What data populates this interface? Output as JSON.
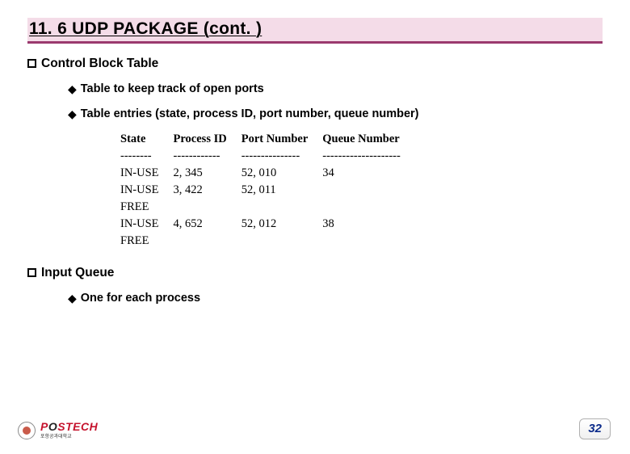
{
  "slide": {
    "title": "11. 6 UDP PACKAGE (cont. )",
    "page_number": "32"
  },
  "sections": [
    {
      "label": "Control Block Table",
      "items": [
        {
          "text": "Table to keep track of open ports"
        },
        {
          "text": "Table entries (state, process ID, port number, queue number)"
        }
      ]
    },
    {
      "label": "Input Queue",
      "items": [
        {
          "text": "One for each process"
        }
      ]
    }
  ],
  "table": {
    "headers": {
      "c0": "State",
      "c1": "Process ID",
      "c2": "Port Number",
      "c3": "Queue Number"
    },
    "dashes": {
      "c0": "--------",
      "c1": "------------",
      "c2": "---------------",
      "c3": "--------------------"
    },
    "rows": [
      {
        "c0": "IN-USE",
        "c1": "2, 345",
        "c2": "52, 010",
        "c3": "34"
      },
      {
        "c0": "IN-USE",
        "c1": "3, 422",
        "c2": "52, 011",
        "c3": ""
      },
      {
        "c0": "FREE",
        "c1": "",
        "c2": "",
        "c3": ""
      },
      {
        "c0": "IN-USE",
        "c1": "4, 652",
        "c2": "52, 012",
        "c3": "38"
      },
      {
        "c0": "FREE",
        "c1": "",
        "c2": "",
        "c3": ""
      }
    ]
  },
  "logo": {
    "name": "POSTECH",
    "sub": "포항공과대학교"
  }
}
